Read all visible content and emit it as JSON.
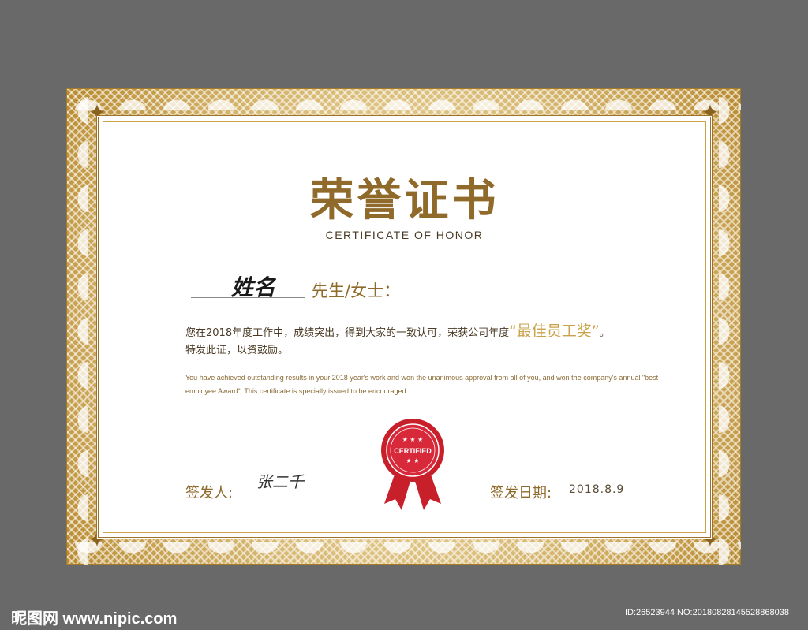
{
  "certificate": {
    "title": "荣誉证书",
    "subtitle": "CERTIFICATE OF HONOR",
    "name_signature": "姓名",
    "honorific": "先生/女士：",
    "body_cn_1": "您在2018年度工作中，成绩突出，得到大家的一致认可，荣获公司年度",
    "award_name": "“最佳员工奖”",
    "body_cn_end": "。",
    "body_cn_2": "特发此证，以资鼓励。",
    "body_en": "You have achieved outstanding results in your 2018 year's work and won the unanimous approval from all of you, and won the company's annual \"best employee Award\". This certificate is specially issued to be encouraged.",
    "seal_text": "CERTIFIED",
    "issuer_label": "签发人:",
    "issuer_signature": "张二千",
    "date_label": "签发日期:",
    "date_value": "2018.8.9"
  },
  "watermark": {
    "site": "昵图网 www.nipic.com",
    "id_line": "ID:26523944 NO:20180828145528868038"
  },
  "colors": {
    "gold": "#8f6a2a",
    "light_gold": "#c9a24a",
    "seal_red": "#c8202b",
    "background": "#696969"
  }
}
